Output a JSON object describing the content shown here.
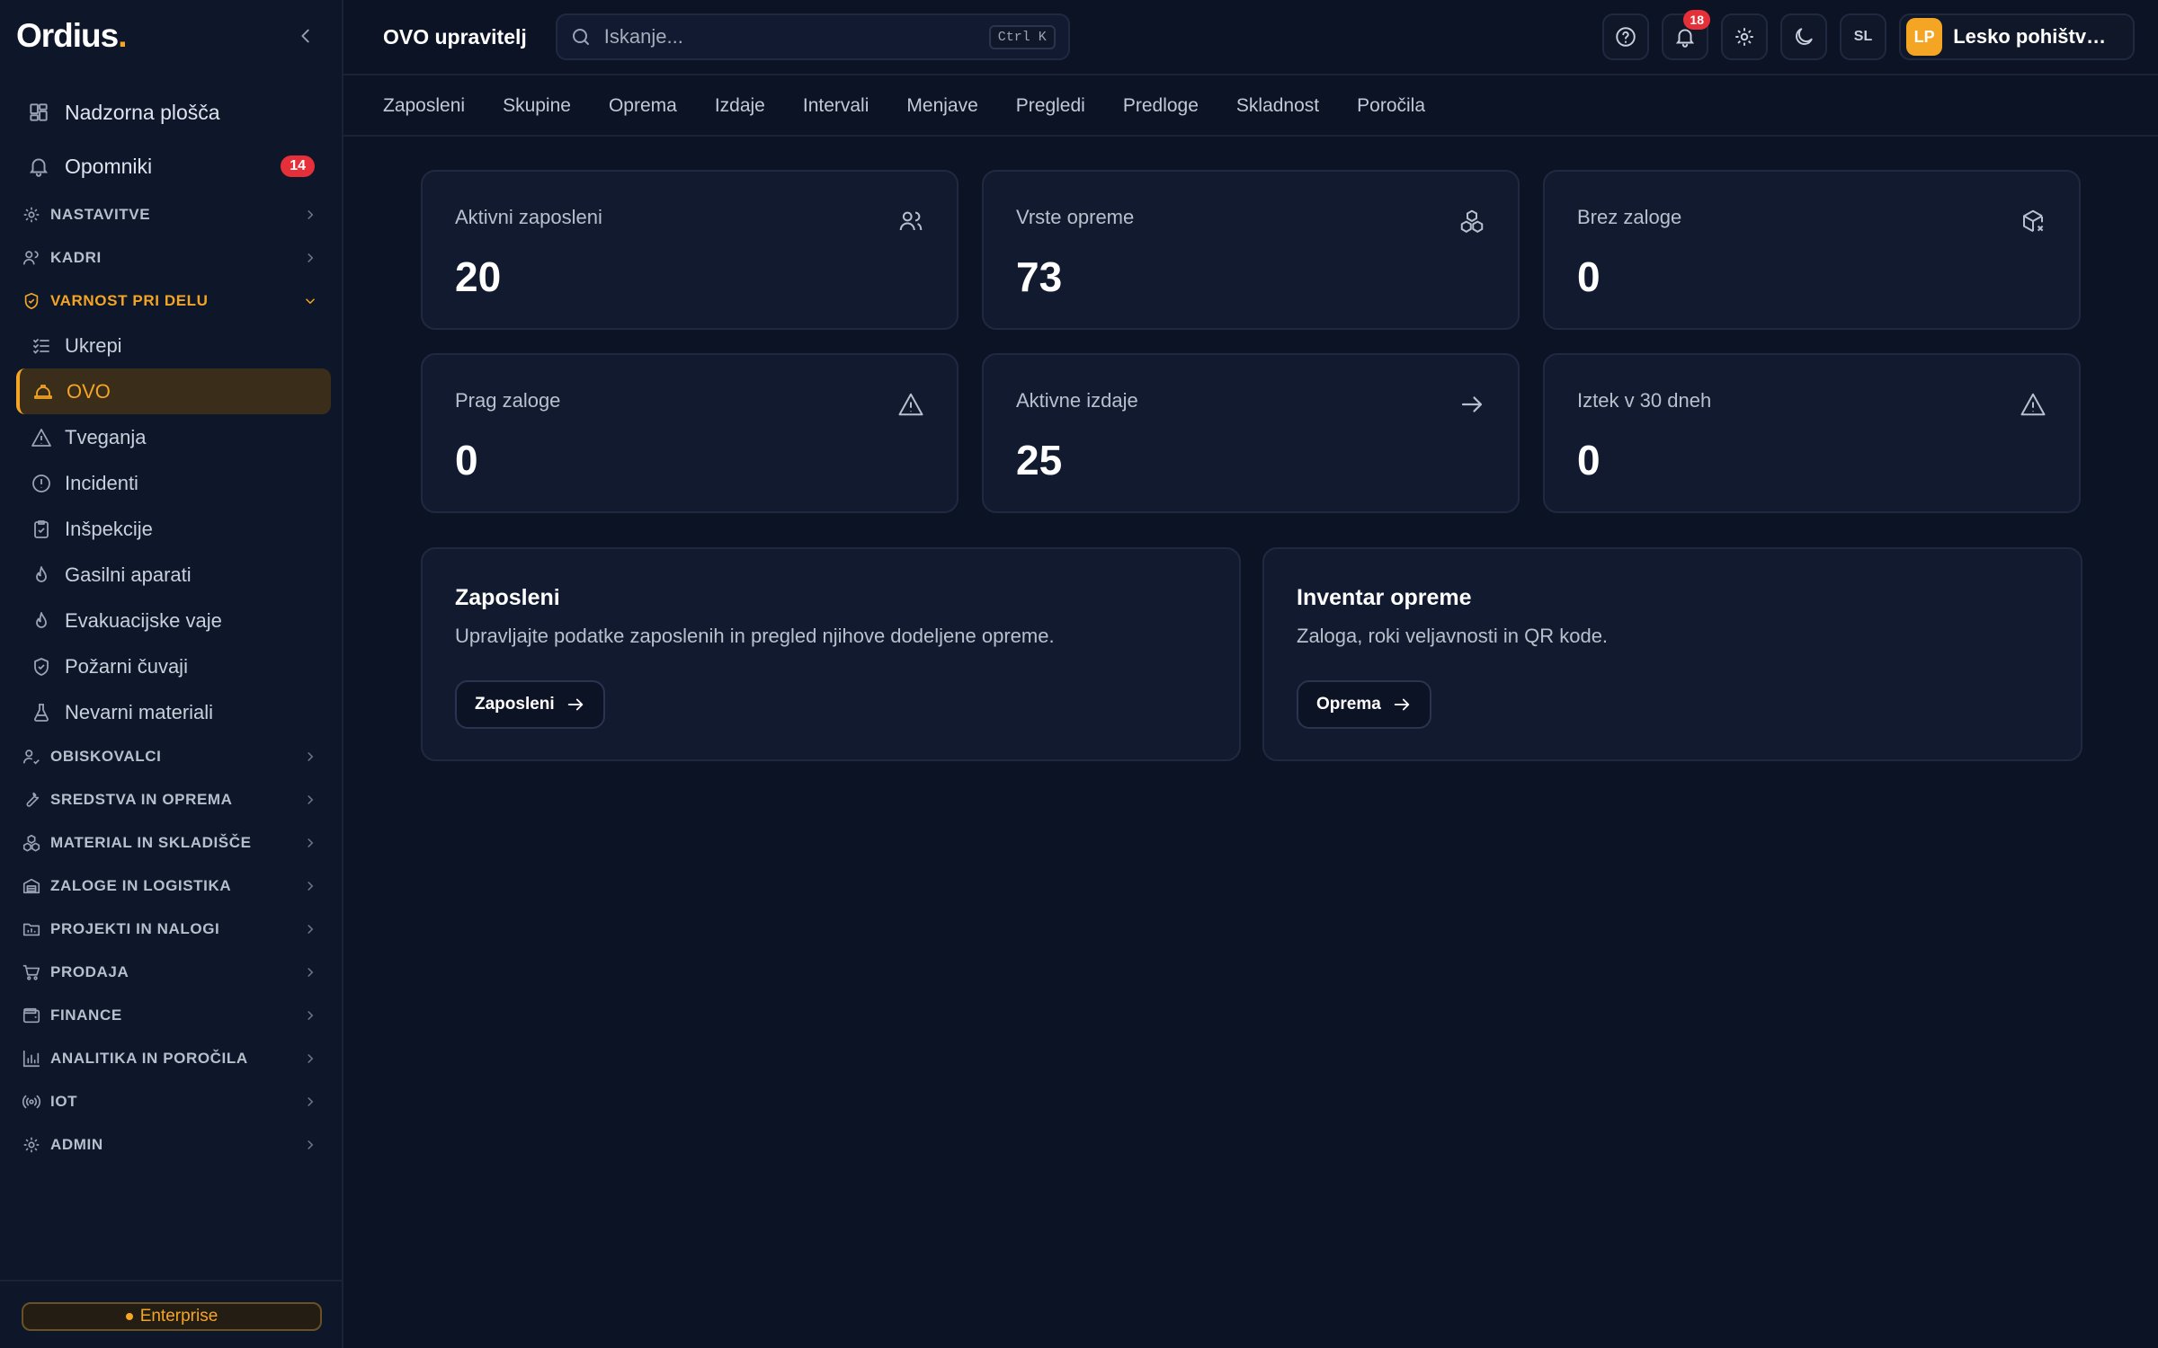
{
  "brand": {
    "logo_text": "Ordius",
    "logo_dot": ".",
    "accent": "#f5a524"
  },
  "sidebar": {
    "top_items": [
      {
        "label": "Nadzorna plošča",
        "icon": "dashboard-icon"
      },
      {
        "label": "Opomniki",
        "icon": "bell-icon",
        "badge": "14"
      }
    ],
    "sections": [
      {
        "label": "NASTAVITVE",
        "icon": "gear-icon"
      },
      {
        "label": "KADRI",
        "icon": "users-icon"
      },
      {
        "label": "VARNOST PRI DELU",
        "icon": "shield-icon",
        "expanded": true
      }
    ],
    "safety_items": [
      {
        "label": "Ukrepi",
        "icon": "checklist-icon"
      },
      {
        "label": "OVO",
        "icon": "hardhat-icon",
        "active": true
      },
      {
        "label": "Tveganja",
        "icon": "warning-icon"
      },
      {
        "label": "Incidenti",
        "icon": "alert-circle-icon"
      },
      {
        "label": "Inšpekcije",
        "icon": "clipboard-check-icon"
      },
      {
        "label": "Gasilni aparati",
        "icon": "flame-icon"
      },
      {
        "label": "Evakuacijske vaje",
        "icon": "flame-icon"
      },
      {
        "label": "Požarni čuvaji",
        "icon": "shield-check-icon"
      },
      {
        "label": "Nevarni materiali",
        "icon": "flask-icon"
      }
    ],
    "more_sections": [
      {
        "label": "OBISKOVALCI",
        "icon": "user-check-icon"
      },
      {
        "label": "SREDSTVA IN OPREMA",
        "icon": "wrench-icon"
      },
      {
        "label": "MATERIAL IN SKLADIŠČE",
        "icon": "boxes-icon"
      },
      {
        "label": "ZALOGE IN LOGISTIKA",
        "icon": "warehouse-icon"
      },
      {
        "label": "PROJEKTI IN NALOGI",
        "icon": "folder-icon"
      },
      {
        "label": "PRODAJA",
        "icon": "cart-icon"
      },
      {
        "label": "FINANCE",
        "icon": "wallet-icon"
      },
      {
        "label": "ANALITIKA IN POROČILA",
        "icon": "bar-chart-icon"
      },
      {
        "label": "IOT",
        "icon": "radio-icon"
      },
      {
        "label": "ADMIN",
        "icon": "gear-icon"
      }
    ],
    "plan_label": "Enterprise"
  },
  "topbar": {
    "title": "OVO upravitelj",
    "search_placeholder": "Iskanje...",
    "search_shortcut": "Ctrl K",
    "notifications_count": "18",
    "language": "SL",
    "org_initials": "LP",
    "org_name": "Lesko pohištvo d..."
  },
  "tabs": [
    "Zaposleni",
    "Skupine",
    "Oprema",
    "Izdaje",
    "Intervali",
    "Menjave",
    "Pregledi",
    "Predloge",
    "Skladnost",
    "Poročila"
  ],
  "stats": [
    {
      "label": "Aktivni zaposleni",
      "value": "20",
      "icon": "users-icon"
    },
    {
      "label": "Vrste opreme",
      "value": "73",
      "icon": "boxes-icon"
    },
    {
      "label": "Brez zaloge",
      "value": "0",
      "icon": "package-x-icon"
    },
    {
      "label": "Prag zaloge",
      "value": "0",
      "icon": "warning-icon"
    },
    {
      "label": "Aktivne izdaje",
      "value": "25",
      "icon": "arrow-right-icon"
    },
    {
      "label": "Iztek v 30 dneh",
      "value": "0",
      "icon": "warning-icon"
    }
  ],
  "cards": [
    {
      "title": "Zaposleni",
      "description": "Upravljajte podatke zaposlenih in pregled njihove dodeljene opreme.",
      "button": "Zaposleni"
    },
    {
      "title": "Inventar opreme",
      "description": "Zaloga, roki veljavnosti in QR kode.",
      "button": "Oprema"
    }
  ]
}
